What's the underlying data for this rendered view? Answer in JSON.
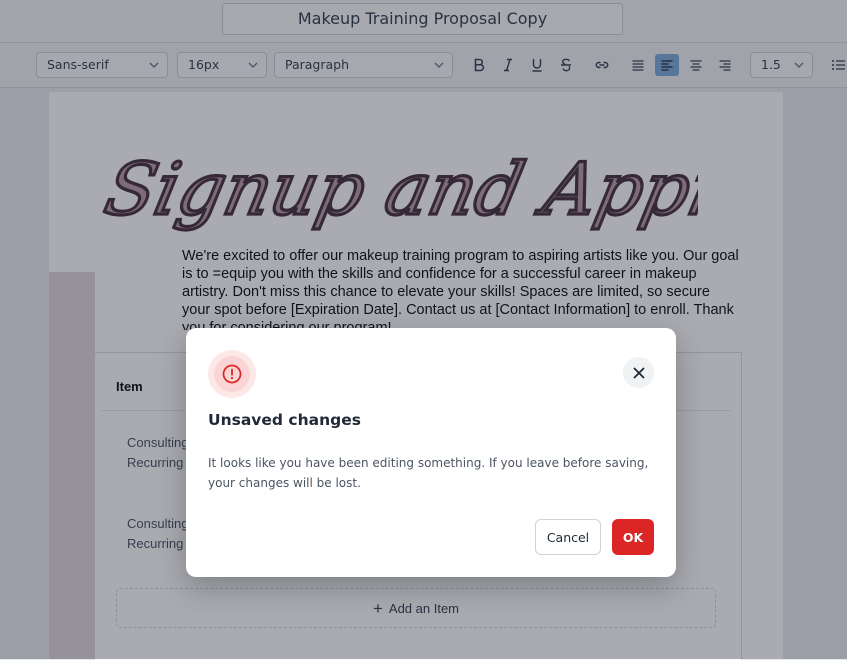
{
  "document": {
    "title": "Makeup Training Proposal Copy",
    "signature_heading": "Signup and Approval",
    "intro_text": "We're excited to offer our makeup training program to aspiring artists like you. Our goal is to =equip you with the skills and confidence for a successful career in makeup artistry. Don't miss this chance to elevate your skills! Spaces are limited, so secure your spot before [Expiration Date]. Contact us at [Contact Information] to enroll. Thank you for considering our program!",
    "items_table": {
      "column_header": "Item",
      "rows": [
        {
          "line1": "Consulting",
          "line2": "Recurring -"
        },
        {
          "line1": "Consulting",
          "line2": "Recurring"
        }
      ],
      "add_item_label": "Add an Item"
    }
  },
  "toolbar": {
    "font_family": "Sans-serif",
    "font_size": "16px",
    "block_style": "Paragraph",
    "line_height": "1.5",
    "active_alignment": "align-left",
    "accent_color": "#7ea9d8"
  },
  "modal": {
    "title": "Unsaved changes",
    "message": "It looks like you have been editing something. If you leave before saving, your changes will be lost.",
    "cancel_label": "Cancel",
    "ok_label": "OK",
    "icon": "alert-circle-icon",
    "danger_color": "#dc2626"
  }
}
